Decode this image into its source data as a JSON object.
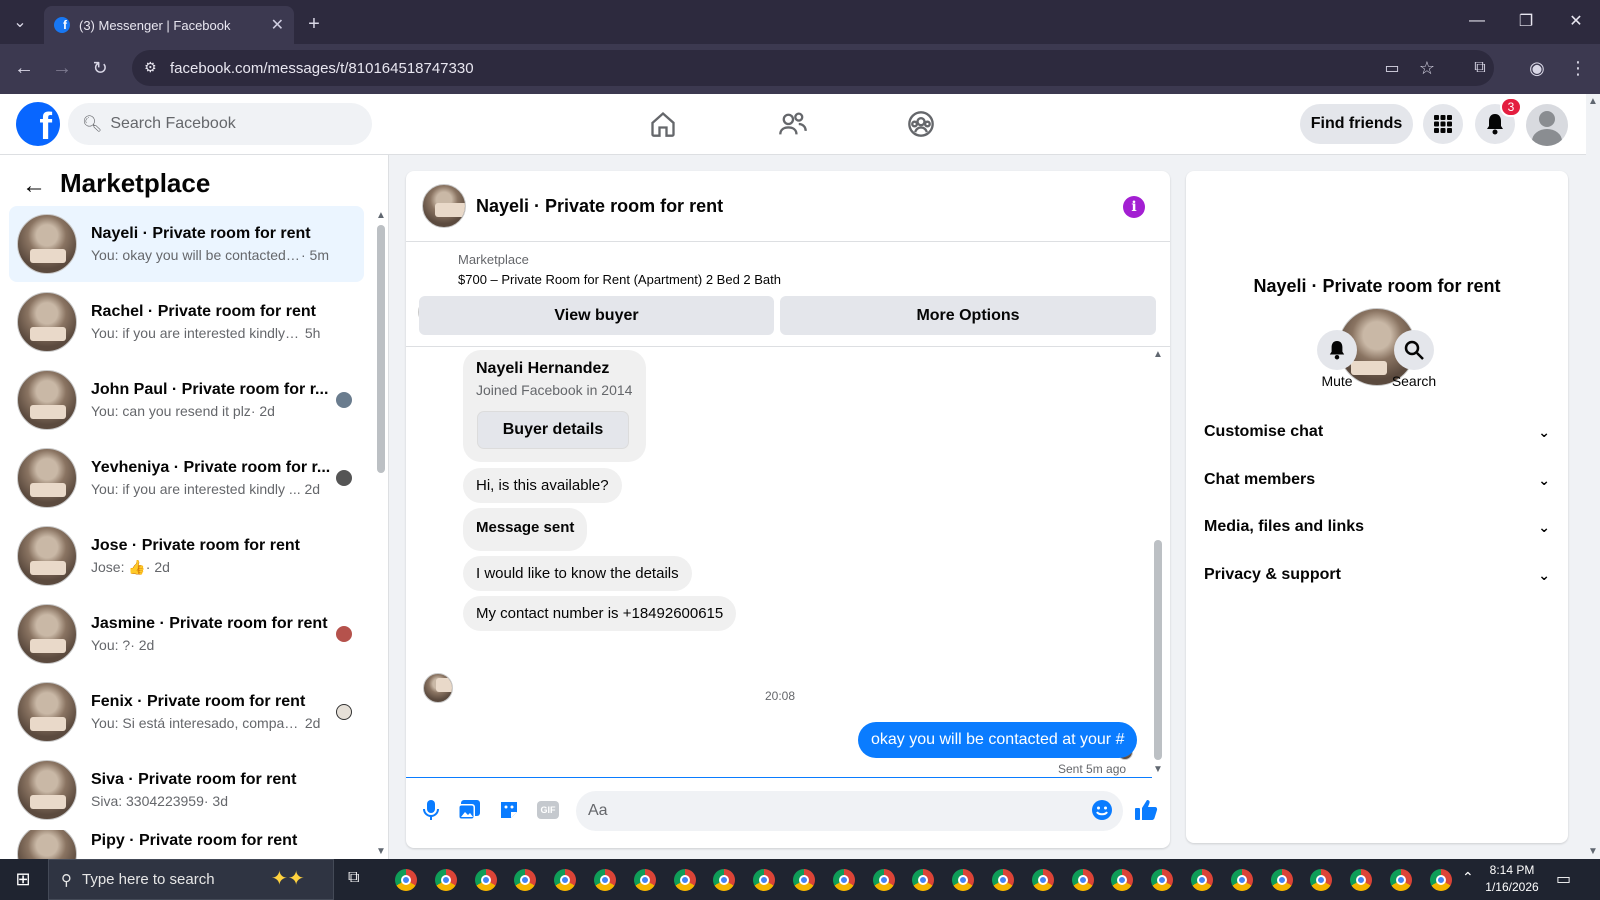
{
  "browser": {
    "tab_title": "(3) Messenger | Facebook",
    "tab_favicon": "facebook-icon",
    "new_tab_glyph": "+",
    "url": "facebook.com/messages/t/810164518747330"
  },
  "fb_header": {
    "search_placeholder": "Search Facebook",
    "find_friends": "Find friends",
    "notification_count": "3",
    "brand_color": "#0866ff"
  },
  "sidebar": {
    "title": "Marketplace",
    "conversations": [
      {
        "name": "Nayeli · Private room for rent",
        "preview": "You: okay you will be contacted at ...",
        "time": "· 5m",
        "active": true
      },
      {
        "name": "Rachel · Private room for rent",
        "preview": "You: if you are interested kindly sha...",
        "time": "5h"
      },
      {
        "name": "John Paul · Private room for r...",
        "preview": "You: can you resend it plz",
        "time": "· 2d"
      },
      {
        "name": "Yevheniya · Private room for r...",
        "preview": "You: if you are interested kindly ...",
        "time": "2d"
      },
      {
        "name": "Jose · Private room for rent",
        "preview": "Jose: 👍",
        "time": "· 2d"
      },
      {
        "name": "Jasmine · Private room for rent",
        "preview": "You: ?",
        "time": "· 2d"
      },
      {
        "name": "Fenix · Private room for rent",
        "preview": "You: Si está interesado, compart...",
        "time": "2d"
      },
      {
        "name": "Siva · Private room for rent",
        "preview": "Siva: 3304223959",
        "time": "· 3d"
      },
      {
        "name": "Pipy · Private room for rent",
        "preview": "",
        "time": ""
      }
    ]
  },
  "chat": {
    "title": "Nayeli · Private room for rent",
    "marketplace_label": "Marketplace",
    "listing": "$700 – Private Room for Rent (Apartment) 2 Bed 2 Bath",
    "view_buyer": "View buyer",
    "more_options": "More Options",
    "buyer_card": {
      "name": "Nayeli Hernandez",
      "joined": "Joined Facebook in 2014",
      "button": "Buyer details"
    },
    "messages": [
      {
        "text": "Hi, is this available?",
        "bold": false
      },
      {
        "text": "Message sent",
        "bold": true
      },
      {
        "text": "I would like to know the details",
        "bold": false
      },
      {
        "text": "My contact number is +18492600615",
        "bold": false
      }
    ],
    "timestamp": "20:08",
    "my_message": "okay you will be contacted at your #",
    "sent_status": "Sent 5m ago",
    "composer_placeholder": "Aa",
    "accent_color": "#0a7cff"
  },
  "right_panel": {
    "name": "Nayeli · Private room for rent",
    "mute": "Mute",
    "search": "Search",
    "sections": [
      "Customise chat",
      "Chat members",
      "Media, files and links",
      "Privacy & support"
    ]
  },
  "taskbar": {
    "search_placeholder": "Type here to search",
    "time": "8:14 PM",
    "date": "1/16/2026"
  }
}
